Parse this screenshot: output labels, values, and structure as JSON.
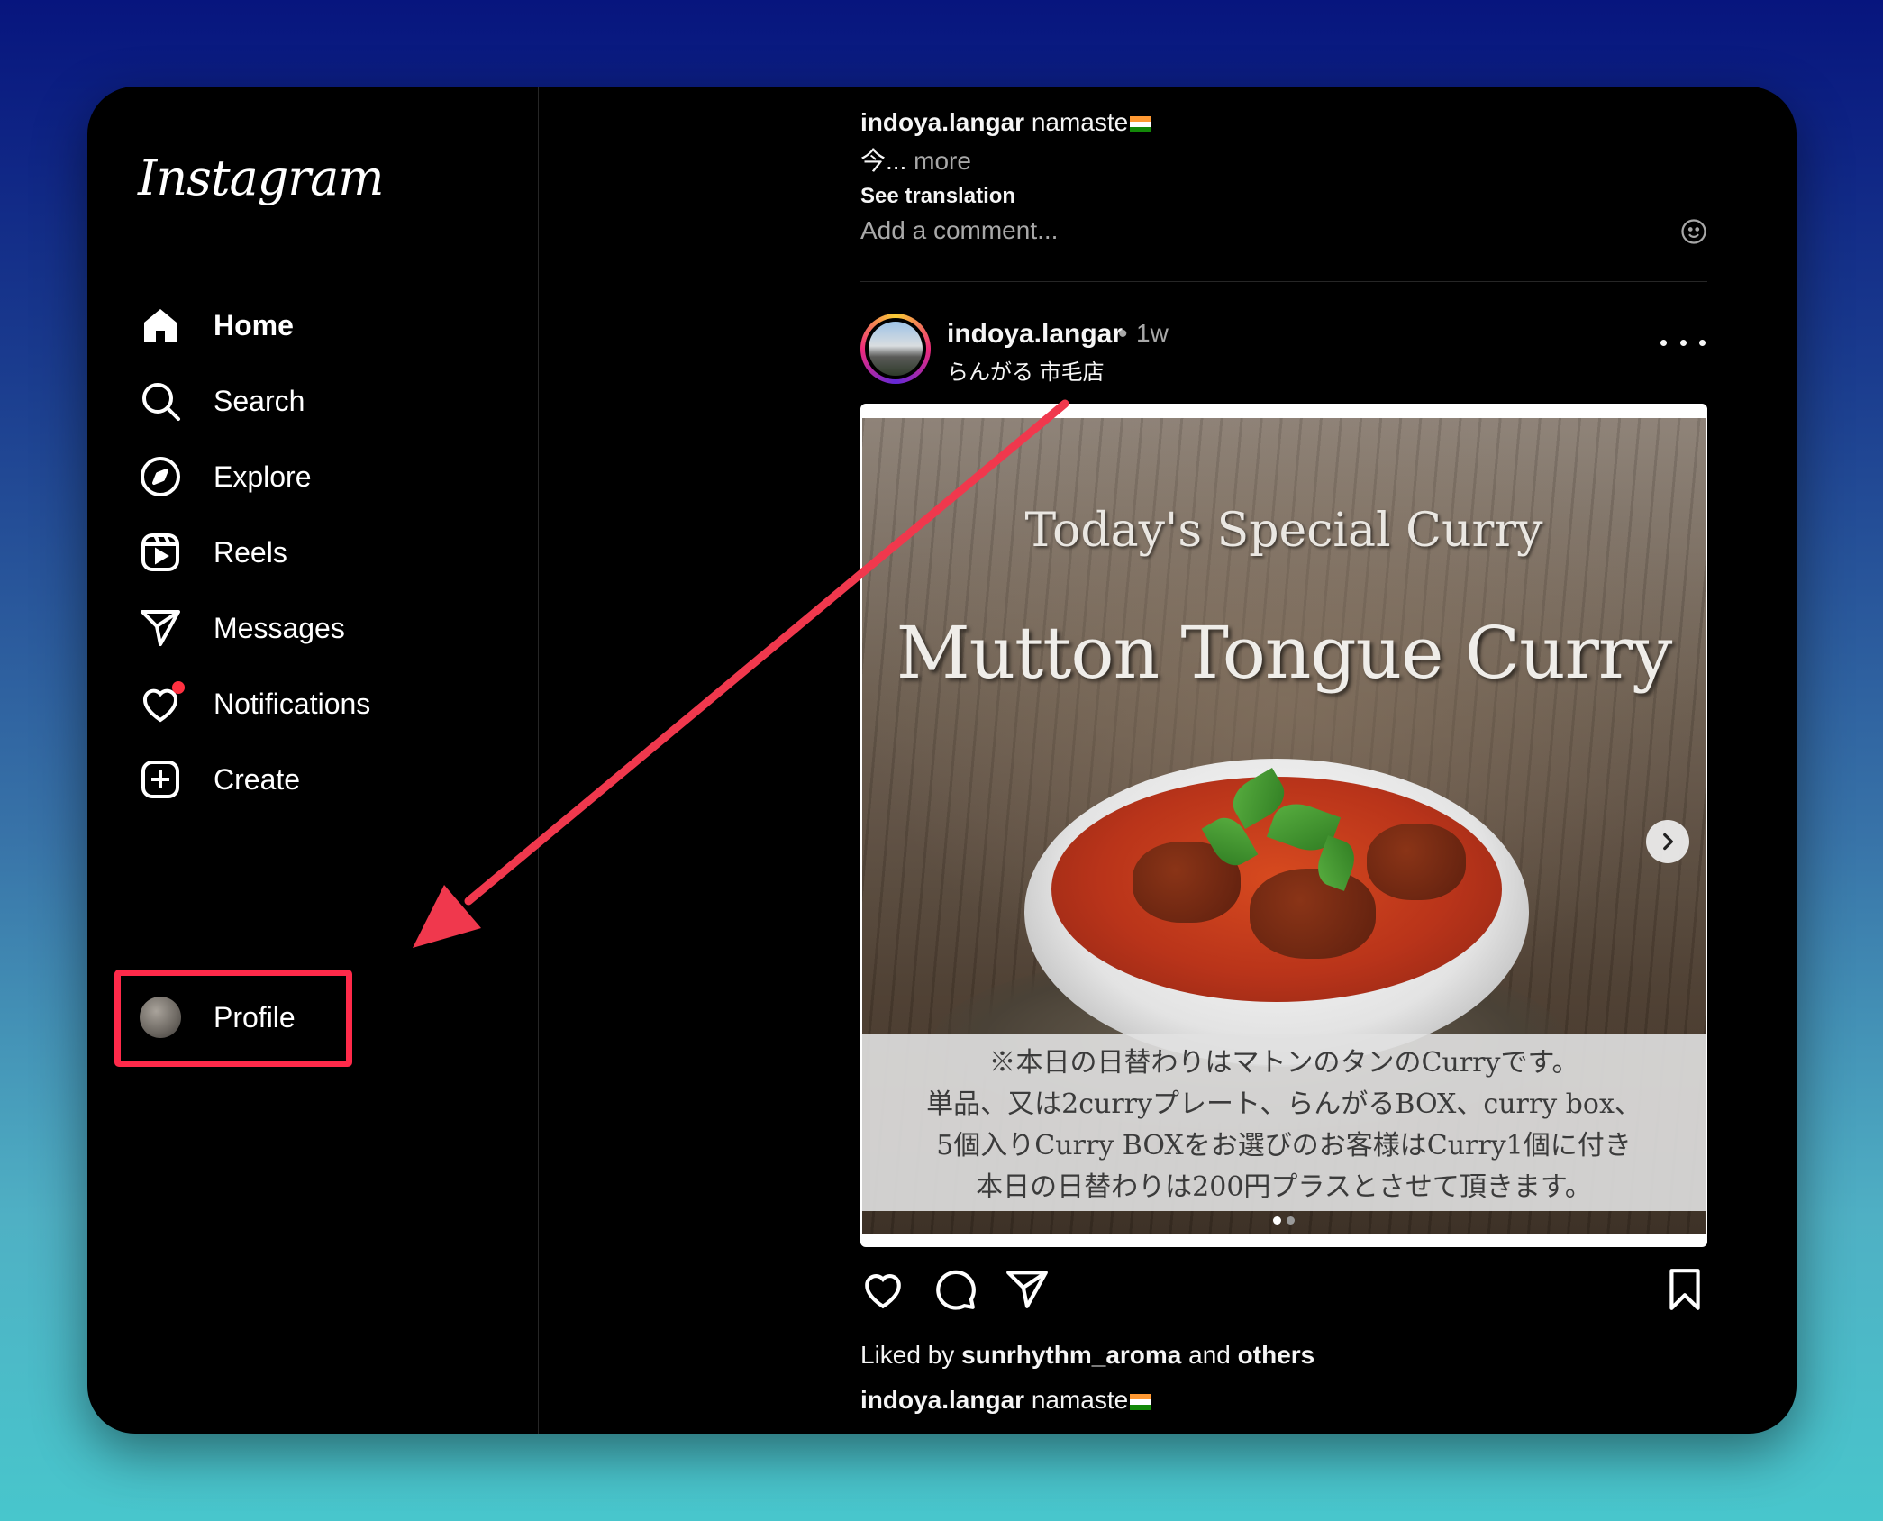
{
  "app": {
    "logo": "Instagram"
  },
  "sidebar": {
    "items": [
      {
        "label": "Home",
        "icon": "home-icon"
      },
      {
        "label": "Search",
        "icon": "search-icon"
      },
      {
        "label": "Explore",
        "icon": "compass-icon"
      },
      {
        "label": "Reels",
        "icon": "reels-icon"
      },
      {
        "label": "Messages",
        "icon": "paper-plane-icon"
      },
      {
        "label": "Notifications",
        "icon": "heart-icon"
      },
      {
        "label": "Create",
        "icon": "plus-square-icon"
      },
      {
        "label": "Profile",
        "icon": "avatar"
      }
    ],
    "active": "Home",
    "notifications_dot": true
  },
  "previous_post": {
    "username": "indoya.langar",
    "caption": "namaste",
    "caption_line2": "今...",
    "more_label": "more",
    "see_translation": "See translation",
    "comment_placeholder": "Add a comment..."
  },
  "post": {
    "username": "indoya.langar",
    "separator": "•",
    "time": "1w",
    "location": "らんがる 市毛店",
    "image": {
      "title_small": "Today's Special Curry",
      "title_large": "Mutton Tongue Curry",
      "jp_text": [
        "※本日の日替わりはマトンのタンのCurryです。",
        "単品、又は2curryプレート、らんがるBOX、curry box、",
        "5個入りCurry BOXをお選びのお客様はCurry1個に付き",
        "本日の日替わりは200円プラスとさせて頂きます。"
      ],
      "carousel_index": 1,
      "carousel_count": 2
    },
    "liked_prefix": "Liked by",
    "liked_user": "sunrhythm_aroma",
    "liked_and": "and",
    "liked_others": "others",
    "caption_user": "indoya.langar",
    "caption": "namaste"
  },
  "annotation": {
    "highlight_color": "#ff2a4a",
    "arrow_color": "#f0384d"
  },
  "colors": {
    "background": "#000000",
    "text": "#f5f5f5",
    "muted": "#a8a8a8",
    "notification": "#ff3040"
  }
}
